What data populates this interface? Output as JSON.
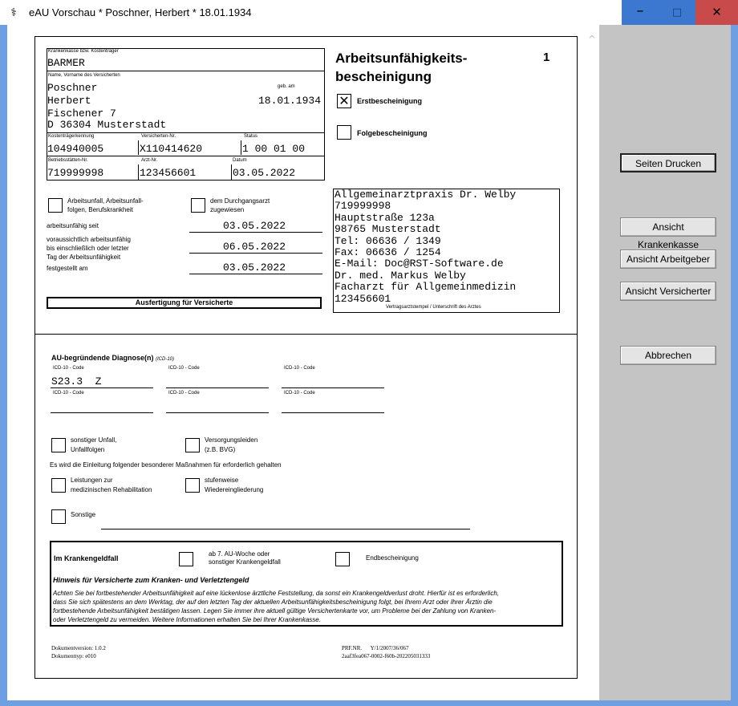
{
  "window": {
    "title": "eAU Vorschau * Poschner, Herbert * 18.01.1934",
    "icon": "caduceus-icon",
    "minimize": "–",
    "maximize": "□",
    "close": "✕"
  },
  "sidebar": {
    "print": "Seiten Drucken",
    "view_kk": "Ansicht Krankenkasse",
    "view_ag": "Ansicht Arbeitgeber",
    "view_vers": "Ansicht Versicherter",
    "cancel": "Abbrechen"
  },
  "form": {
    "kk_label": "Krankenkasse bzw. Kostenträger",
    "kk_value": "BARMER",
    "name_label": "Name, Vorname des Versicherten",
    "lastname": "Poschner",
    "geb_label": "geb. am",
    "firstname": "Herbert",
    "birthdate": "18.01.1934",
    "street": "Fischener 7",
    "city": "D 36304 Musterstadt",
    "ktk_label": "Kostenträgerkennung",
    "ktk_value": "104940005",
    "vnr_label": "Versicherten-Nr.",
    "vnr_value": "X110414620",
    "status_label": "Status",
    "status_value": "1 00 01 00",
    "bsnr_label": "Betriebsstätten-Nr.",
    "bsnr_value": "719999998",
    "lanr_label": "Arzt-Nr.",
    "lanr_value": "123456601",
    "datum_label": "Datum",
    "datum_value": "03.05.2022",
    "heading_line1": "Arbeitsunfähigkeits-",
    "heading_line2": "bescheinigung",
    "heading_number": "1",
    "erst": "Erstbescheinigung",
    "erst_mark": "✕",
    "folge": "Folgebescheinigung",
    "arbeitsunfall_l1": "Arbeitsunfall, Arbeitsunfall-",
    "arbeitsunfall_l2": "folgen, Berufskrankheit",
    "durchgang_l1": "dem Durchgangsarzt",
    "durchgang_l2": "zugewiesen",
    "seit_label": "arbeitsunfähig seit",
    "seit_value": "03.05.2022",
    "bis_l1": "voraussichtlich arbeitsunfähig",
    "bis_l2": "bis einschließlich oder letzter",
    "bis_l3": "Tag der Arbeitsunfähigkeit",
    "bis_value": "06.05.2022",
    "festgestellt_label": "festgestellt am",
    "festgestellt_value": "03.05.2022",
    "ausfertigung": "Ausfertigung für Versicherte",
    "stamp": [
      "Allgemeinarztpraxis Dr. Welby",
      "719999998",
      "Hauptstraße 123a",
      "98765 Musterstadt",
      "Tel: 06636 / 1349",
      "Fax: 06636 / 1254",
      "E-Mail: Doc@RST-Software.de",
      "Dr. med. Markus Welby",
      "Facharzt für Allgemeinmedizin",
      "123456601"
    ],
    "stamp_caption": "Vertragsarztstempel / Unterschrift des Arztes",
    "diag_heading": "AU-begründende Diagnose(n)",
    "diag_suffix": "(ICD-10)",
    "icd_label": "ICD-10 - Code",
    "icd1": "S23.3  Z",
    "unfall_l1": "sonstiger Unfall,",
    "unfall_l2": "Unfallfolgen",
    "versorgung_l1": "Versorgungsleiden",
    "versorgung_l2": "(z.B. BVG)",
    "massnahmen": "Es wird die Einleitung folgender besonderer Maßnahmen für erforderlich gehalten",
    "reha_l1": "Leistungen zur",
    "reha_l2": "medizinischen Rehabilitation",
    "stufen_l1": "stufenweise",
    "stufen_l2": "Wiedereingliederung",
    "sonstige": "Sonstige",
    "krankengeld": "Im Krankengeldfall",
    "woche_l1": "ab 7. AU-Woche oder",
    "woche_l2": "sonstiger Krankengeldfall",
    "endbesch": "Endbescheinigung",
    "hinweis_title": "Hinweis für Versicherte zum Kranken- und Verletztengeld",
    "hinweis_l1": "Achten Sie bei fortbestehender Arbeitsunfähigkeit auf eine lückenlose ärztliche Feststellung, da sonst ein Krankengeldverlust droht. Hierfür ist es erforderlich,",
    "hinweis_l2": "dass Sie sich spätestens an dem Werktag, der auf den letzten Tag der aktuellen Arbeitsunfähigkeitsbescheinigung folgt, bei Ihrem Arzt oder Ihrer Ärztin die",
    "hinweis_l3": "fortbestehende Arbeitsunfähigkeit bestätigen lassen. Legen Sie immer ihre aktuell gültige Versichertenkarte vor, um Probleme bei der Zahlung von Kranken-",
    "hinweis_l4": "oder Verletztengeld zu vermeiden. Weitere Informationen erhalten Sie bei Ihrer Krankenkasse.",
    "docversion": "Dokumentversion: 1.0.2",
    "doctyp": "Dokumenttyp: e010",
    "prf_label": "PRF.NR.",
    "prf_value": "Y/1/2007/36/067",
    "docid": "2aaf3fea067-0002-f60b-202205031333"
  }
}
